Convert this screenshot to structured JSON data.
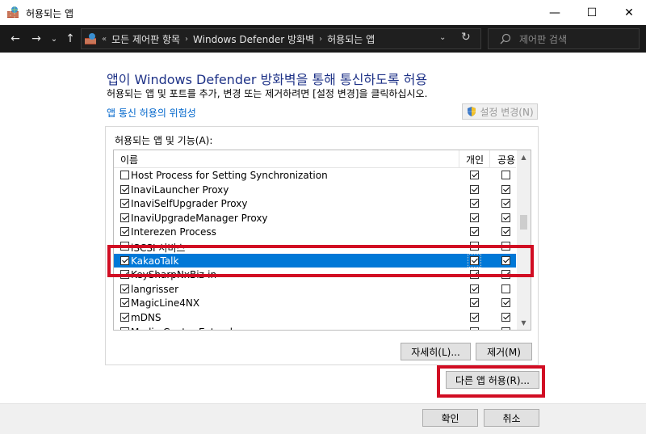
{
  "window": {
    "title": "허용되는 앱",
    "minimize": "—",
    "maximize": "☐",
    "close": "✕"
  },
  "nav": {
    "back": "←",
    "forward": "→",
    "history": "⌄",
    "up": "↑",
    "overflow": "«",
    "breadcrumbs": [
      "모든 제어판 항목",
      "Windows Defender 방화벽",
      "허용되는 앱"
    ],
    "separator": "›",
    "dropdown": "⌄",
    "refresh": "↻",
    "search_placeholder": "제어판 검색"
  },
  "main": {
    "heading": "앱이 Windows Defender 방화벽을 통해 통신하도록 허용",
    "description": "허용되는 앱 및 포트를 추가, 변경 또는 제거하려면 [설정 변경]을 클릭하십시오.",
    "risk_link": "앱 통신 허용의 위험성",
    "change_settings": "설정 변경(N)",
    "group_label": "허용되는 앱 및 기능(A):",
    "columns": {
      "name": "이름",
      "private": "개인",
      "public": "공용"
    },
    "apps": [
      {
        "name": "Host Process for Setting Synchronization",
        "enabled": false,
        "private": true,
        "public": false
      },
      {
        "name": "InaviLauncher Proxy",
        "enabled": true,
        "private": true,
        "public": true
      },
      {
        "name": "InaviSelfUpgrader Proxy",
        "enabled": true,
        "private": true,
        "public": true
      },
      {
        "name": "InaviUpgradeManager Proxy",
        "enabled": true,
        "private": true,
        "public": true
      },
      {
        "name": "Interezen Process",
        "enabled": true,
        "private": true,
        "public": true
      },
      {
        "name": "iSCSI 서비스",
        "enabled": false,
        "private": false,
        "public": false
      },
      {
        "name": "KakaoTalk",
        "enabled": true,
        "private": true,
        "public": true,
        "selected": true
      },
      {
        "name": "KeySharpNxBiz-in",
        "enabled": true,
        "private": true,
        "public": true
      },
      {
        "name": "langrisser",
        "enabled": true,
        "private": true,
        "public": false
      },
      {
        "name": "MagicLine4NX",
        "enabled": true,
        "private": true,
        "public": true
      },
      {
        "name": "mDNS",
        "enabled": true,
        "private": true,
        "public": true
      },
      {
        "name": "Media Center Extender",
        "enabled": false,
        "private": false,
        "public": false
      }
    ],
    "details_button": "자세히(L)...",
    "remove_button": "제거(M)",
    "allow_other_button": "다른 앱 허용(R)..."
  },
  "footer": {
    "ok": "확인",
    "cancel": "취소"
  },
  "colors": {
    "selection": "#0078d7",
    "highlight_box": "#d10d23",
    "heading": "#1e3287",
    "link": "#0066cc"
  }
}
